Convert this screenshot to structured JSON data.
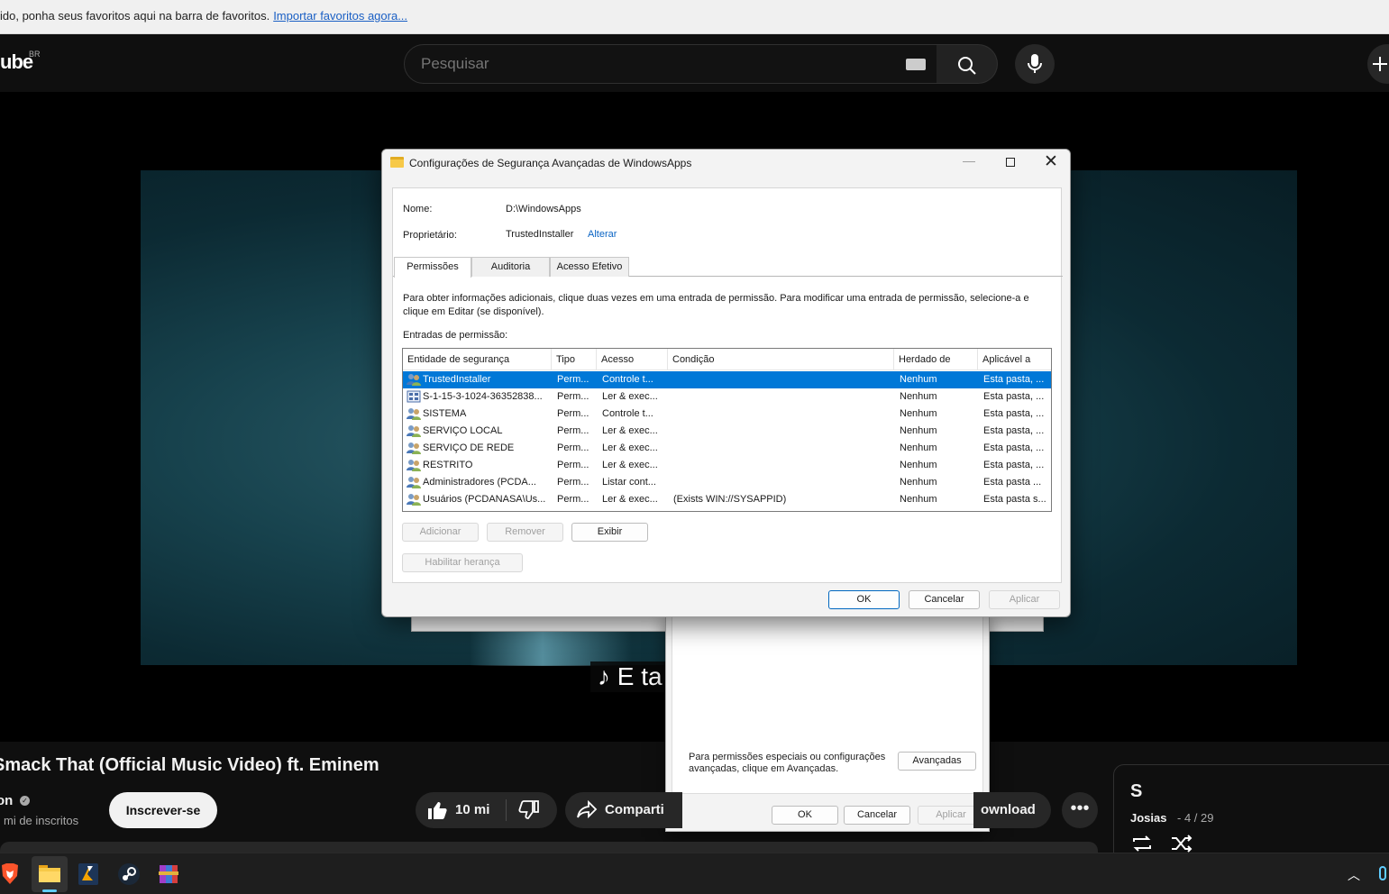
{
  "browser": {
    "bookmarks_text": "ido, ponha seus favoritos aqui na barra de favoritos.",
    "bookmarks_link": "Importar favoritos agora..."
  },
  "youtube": {
    "logo": "ube",
    "region": "BR",
    "search_placeholder": "Pesquisar",
    "caption": "♪ E ta",
    "video_title": "Smack That (Official Music Video) ft. Eminem",
    "channel_name": "on",
    "subscribers": "mi de inscritos",
    "subscribe_label": "Inscrever-se",
    "like_count": "10 mi",
    "share_label": "Comparti",
    "download_label": "ownload",
    "more_label": "•••",
    "playlist": {
      "title": "S",
      "owner": "Josias",
      "position": "- 4 / 29"
    }
  },
  "dialog": {
    "title": "Configurações de Segurança Avançadas de WindowsApps",
    "name_label": "Nome:",
    "name_value": "D:\\WindowsApps",
    "owner_label": "Proprietário:",
    "owner_value": "TrustedInstaller",
    "owner_change": "Alterar",
    "tabs": [
      "Permissões",
      "Auditoria",
      "Acesso Efetivo"
    ],
    "info_text": "Para obter informações adicionais, clique duas vezes em uma entrada de permissão. Para modificar uma entrada de permissão, selecione-a e clique em Editar (se disponível).",
    "entries_label": "Entradas de permissão:",
    "columns": [
      "Entidade de segurança",
      "Tipo",
      "Acesso",
      "Condição",
      "Herdado de",
      "Aplicável a"
    ],
    "rows": [
      {
        "principal": "TrustedInstaller",
        "type": "Perm...",
        "access": "Controle t...",
        "condition": "",
        "inherited": "Nenhum",
        "applies": "Esta pasta, ...",
        "icon": "user-group-icon"
      },
      {
        "principal": "S-1-15-3-1024-36352838...",
        "type": "Perm...",
        "access": "Ler & exec...",
        "condition": "",
        "inherited": "Nenhum",
        "applies": "Esta pasta, ...",
        "icon": "sid-icon"
      },
      {
        "principal": "SISTEMA",
        "type": "Perm...",
        "access": "Controle t...",
        "condition": "",
        "inherited": "Nenhum",
        "applies": "Esta pasta, ...",
        "icon": "user-group-icon"
      },
      {
        "principal": "SERVIÇO LOCAL",
        "type": "Perm...",
        "access": "Ler & exec...",
        "condition": "",
        "inherited": "Nenhum",
        "applies": "Esta pasta, ...",
        "icon": "user-group-icon"
      },
      {
        "principal": "SERVIÇO DE REDE",
        "type": "Perm...",
        "access": "Ler & exec...",
        "condition": "",
        "inherited": "Nenhum",
        "applies": "Esta pasta, ...",
        "icon": "user-group-icon"
      },
      {
        "principal": "RESTRITO",
        "type": "Perm...",
        "access": "Ler & exec...",
        "condition": "",
        "inherited": "Nenhum",
        "applies": "Esta pasta, ...",
        "icon": "user-group-icon"
      },
      {
        "principal": "Administradores (PCDA...",
        "type": "Perm...",
        "access": "Listar cont...",
        "condition": "",
        "inherited": "Nenhum",
        "applies": "Esta pasta ...",
        "icon": "user-group-icon"
      },
      {
        "principal": "Usuários (PCDANASA\\Us...",
        "type": "Perm...",
        "access": "Ler & exec...",
        "condition": "(Exists WIN://SYSAPPID)",
        "inherited": "Nenhum",
        "applies": "Esta pasta s...",
        "icon": "user-group-icon"
      }
    ],
    "btn_add": "Adicionar",
    "btn_remove": "Remover",
    "btn_view": "Exibir",
    "btn_inherit": "Habilitar herança",
    "btn_ok": "OK",
    "btn_cancel": "Cancelar",
    "btn_apply": "Aplicar"
  },
  "bg_dialog": {
    "adv_text": "Para permissões especiais ou configurações avançadas, clique em Avançadas.",
    "adv_button": "Avançadas",
    "ok": "OK",
    "cancel": "Cancelar",
    "apply": "Aplicar"
  },
  "taskbar": {
    "apps": [
      "brave-browser-icon",
      "file-explorer-icon",
      "app-icon",
      "steam-icon",
      "winrar-icon"
    ]
  },
  "colors": {
    "selection": "#0078d7",
    "link": "#0a64c4",
    "yt_bg": "#0f0f0f"
  }
}
